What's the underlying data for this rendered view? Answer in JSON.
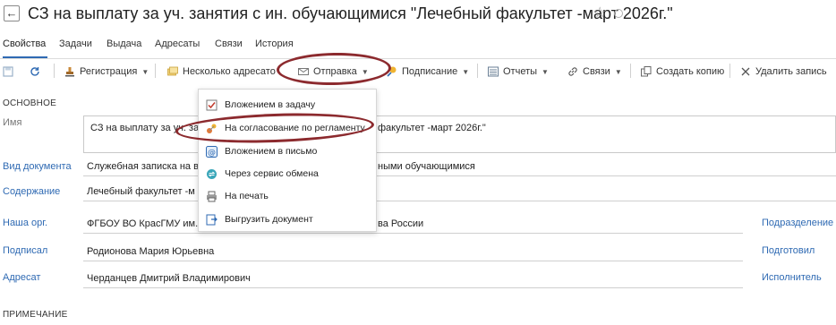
{
  "header": {
    "title": "СЗ на выплату за уч. занятия с ин. обучающимися \"Лечебный факультет -март 2026г.\"",
    "back_icon": "arrow-left-icon",
    "favorite_icon": "star-icon",
    "status_icon": "circle-icon"
  },
  "tabs": [
    "Свойства",
    "Задачи",
    "Выдача",
    "Адресаты",
    "Связи",
    "История"
  ],
  "active_tab": "Свойства",
  "toolbar": {
    "registration": "Регистрация",
    "multiple_addressees": "Несколько адресато",
    "send": "Отправка",
    "signing": "Подписание",
    "reports": "Отчеты",
    "links": "Связи",
    "create_copy": "Создать копию",
    "delete": "Удалить запись"
  },
  "send_menu": [
    {
      "label": "Вложением в задачу",
      "icon": "task-check-icon"
    },
    {
      "label": "На согласование по регламенту",
      "icon": "approval-route-icon"
    },
    {
      "label": "Вложением в письмо",
      "icon": "mail-at-icon"
    },
    {
      "label": "Через сервис обмена",
      "icon": "exchange-service-icon"
    },
    {
      "label": "На печать",
      "icon": "printer-icon"
    },
    {
      "label": "Выгрузить документ",
      "icon": "export-document-icon"
    }
  ],
  "sections": {
    "main": "ОСНОВНОЕ",
    "note": "ПРИМЕЧАНИЕ"
  },
  "fields": {
    "name_label": "Имя",
    "name_value_left": "СЗ на выплату за уч. за",
    "name_value_right": "факультет -март 2026г.\"",
    "doc_type_label": "Вид документа",
    "doc_type_value_left": "Служебная записка на в",
    "doc_type_value_right": "ными обучающимися",
    "content_label": "Содержание",
    "content_value": "Лечебный факультет -м",
    "org_label": "Наша орг.",
    "org_value_left": "ФГБОУ ВО КрасГМУ им.",
    "org_value_right": "ва России",
    "signed_label": "Подписал",
    "signed_value": "Родионова Мария Юрьевна",
    "addressee_label": "Адресат",
    "addressee_value": "Черданцев Дмитрий Владимирович"
  },
  "right_links": {
    "department": "Подразделение",
    "prepared": "Подготовил",
    "executor": "Исполнитель"
  },
  "colors": {
    "link": "#2f6ab3",
    "highlight_oval": "#8c2a2e"
  }
}
